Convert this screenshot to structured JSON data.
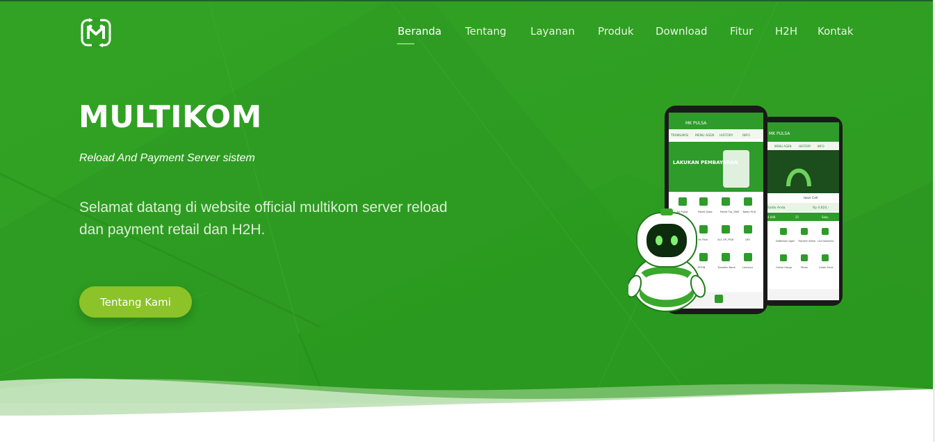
{
  "brand": {
    "logo_name": "multikom-logo-icon"
  },
  "nav": {
    "items": [
      {
        "label": "Beranda",
        "active": true
      },
      {
        "label": "Tentang"
      },
      {
        "label": "Layanan"
      },
      {
        "label": "Produk"
      },
      {
        "label": "Download"
      },
      {
        "label": "Fitur"
      },
      {
        "label": "H2H"
      },
      {
        "label": "Kontak"
      }
    ]
  },
  "hero": {
    "title": "MULTIKOM",
    "tagline": "Reload And Payment Server sistem",
    "welcome": "Selamat datang di website official multikom server reload dan payment retail dan H2H.",
    "cta_label": "Tentang Kami"
  },
  "app_mock": {
    "front": {
      "title": "MK PULSA",
      "tabs": [
        "TRANSAKSI",
        "MENU AGEN",
        "HISTORY",
        "INFO"
      ],
      "banner": "LAKUKAN PEMBAYARAN",
      "menu": [
        "Isi Pulsa",
        "Paket Data",
        "Paket Tlp_SMS",
        "Token PLN",
        "Vo Fisik",
        "ALL OP_PGB",
        "GRI",
        "PPOB",
        "Transfer Bank",
        "Lainnya"
      ]
    },
    "back": {
      "title": "MK PULSA",
      "tabs": [
        "MENU AGEN",
        "HISTORY",
        "INFO"
      ],
      "user": "Iwan Cell",
      "balance_label": "Saldo Anda",
      "balance_value": "Rp 4.824,-",
      "stat_left": "4.848",
      "stat_mid": "25",
      "stat_right": "Saku",
      "menu": [
        "Daftarkan Agen",
        "Transfer Saldo",
        "List Downline",
        "Online Harga",
        "Pesan",
        "Cetak Struk"
      ]
    }
  },
  "colors": {
    "hero_green": "#2d9e22",
    "hero_green_dark": "#25861c",
    "cta_green": "#8bc328",
    "white": "#ffffff"
  }
}
